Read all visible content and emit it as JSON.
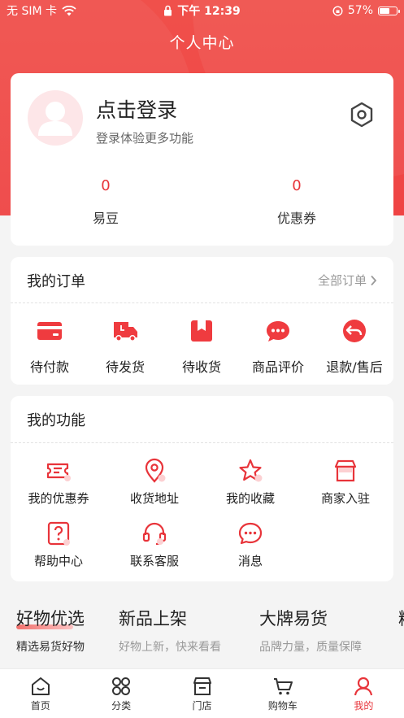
{
  "status_bar": {
    "carrier": "无 SIM 卡",
    "time": "下午 12:39",
    "battery": "57%"
  },
  "page_title": "个人中心",
  "profile": {
    "login_title": "点击登录",
    "login_subtitle": "登录体验更多功能",
    "stats": [
      {
        "value": "0",
        "label": "易豆"
      },
      {
        "value": "0",
        "label": "优惠券"
      }
    ]
  },
  "orders": {
    "title": "我的订单",
    "all_link": "全部订单",
    "items": [
      {
        "label": "待付款",
        "icon": "card-icon"
      },
      {
        "label": "待发货",
        "icon": "truck-icon"
      },
      {
        "label": "待收货",
        "icon": "package-icon"
      },
      {
        "label": "商品评价",
        "icon": "chat-icon"
      },
      {
        "label": "退款/售后",
        "icon": "return-icon"
      }
    ]
  },
  "functions": {
    "title": "我的功能",
    "items": [
      {
        "label": "我的优惠券",
        "icon": "coupon-icon"
      },
      {
        "label": "收货地址",
        "icon": "location-icon"
      },
      {
        "label": "我的收藏",
        "icon": "star-icon"
      },
      {
        "label": "商家入驻",
        "icon": "store-icon"
      },
      {
        "label": "帮助中心",
        "icon": "help-icon"
      },
      {
        "label": "联系客服",
        "icon": "headset-icon"
      },
      {
        "label": "消息",
        "icon": "message-icon"
      }
    ]
  },
  "feature_tabs": [
    {
      "title": "好物优选",
      "subtitle": "精选易货好物",
      "active": true
    },
    {
      "title": "新品上架",
      "subtitle": "好物上新，快来看看"
    },
    {
      "title": "大牌易货",
      "subtitle": "品牌力量，质量保障"
    },
    {
      "title": "精",
      "subtitle": ""
    }
  ],
  "bottom_nav": [
    {
      "label": "首页",
      "icon": "home-icon"
    },
    {
      "label": "分类",
      "icon": "grid-icon"
    },
    {
      "label": "门店",
      "icon": "shop-icon"
    },
    {
      "label": "购物车",
      "icon": "cart-icon"
    },
    {
      "label": "我的",
      "icon": "user-icon",
      "active": true
    }
  ],
  "colors": {
    "accent": "#ef4444",
    "accent_text": "#e8343a"
  }
}
